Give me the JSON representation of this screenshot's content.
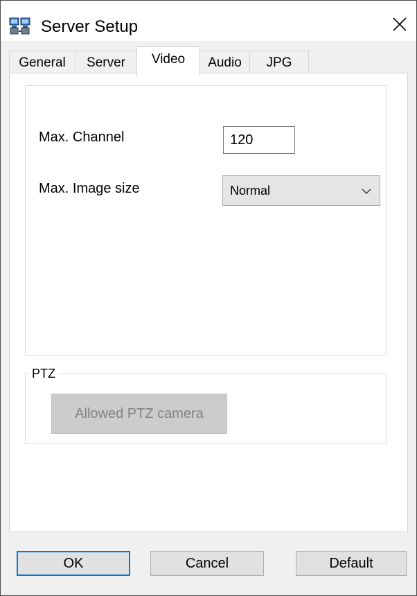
{
  "window": {
    "title": "Server Setup",
    "icon": "server-setup-icon",
    "close_icon": "close-icon"
  },
  "tabs": [
    {
      "label": "General",
      "active": false
    },
    {
      "label": "Server",
      "active": false
    },
    {
      "label": "Video",
      "active": true
    },
    {
      "label": "Audio",
      "active": false
    },
    {
      "label": "JPG",
      "active": false
    }
  ],
  "video": {
    "max_channel_label": "Max. Channel",
    "max_channel_value": "120",
    "max_image_size_label": "Max. Image size",
    "max_image_size_value": "Normal"
  },
  "ptz": {
    "group_label": "PTZ",
    "allowed_button_label": "Allowed PTZ camera"
  },
  "footer": {
    "ok_label": "OK",
    "cancel_label": "Cancel",
    "default_label": "Default"
  },
  "colors": {
    "focus_border": "#0078d7",
    "dialog_bg": "#f0f0f0",
    "disabled_text": "#838383"
  }
}
